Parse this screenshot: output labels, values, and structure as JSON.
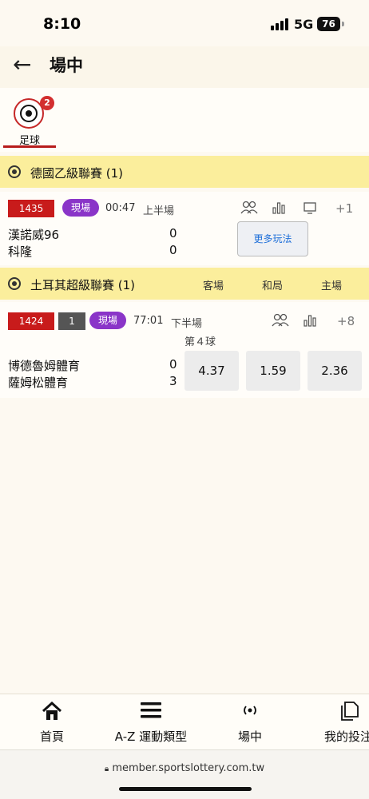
{
  "status_bar": {
    "time": "8:10",
    "network": "5G",
    "battery": "76"
  },
  "header": {
    "back_icon": "←",
    "title": "場中"
  },
  "sport_tabs": [
    {
      "label": "足球",
      "badge": "2",
      "icon": "soccer-ball-icon"
    }
  ],
  "leagues": [
    {
      "name": "德國乙級聯賽 (1)",
      "matches": [
        {
          "id": "1435",
          "live_label": "現場",
          "clock": "00:47",
          "period": "上半場",
          "home": "漢諾威96",
          "home_score": "0",
          "away": "科隆",
          "away_score": "0",
          "icons": [
            "lineup-icon",
            "stats-icon",
            "tv-icon"
          ],
          "more_count": "+1",
          "more_markets_label": "更多玩法"
        }
      ]
    },
    {
      "name": "土耳其超級聯賽 (1)",
      "columns": [
        "客場",
        "和局",
        "主場"
      ],
      "matches": [
        {
          "id": "1424",
          "count_tag": "1",
          "live_label": "現場",
          "clock": "77:01",
          "period": "下半場",
          "goal_note": "第４球",
          "home": "博德魯姆體育",
          "home_score": "0",
          "away": "薩姆松體育",
          "away_score": "3",
          "icons": [
            "lineup-icon",
            "stats-icon"
          ],
          "more_count": "+8",
          "odds": [
            "4.37",
            "1.59",
            "2.36"
          ]
        }
      ]
    }
  ],
  "bottom_nav": [
    {
      "label": "首頁",
      "icon": "home-icon"
    },
    {
      "label": "A-Z 運動類型",
      "icon": "menu-icon"
    },
    {
      "label": "場中",
      "icon": "live-icon"
    },
    {
      "label": "我的投注",
      "icon": "bets-icon"
    }
  ],
  "url": "member.sportslottery.com.tw"
}
